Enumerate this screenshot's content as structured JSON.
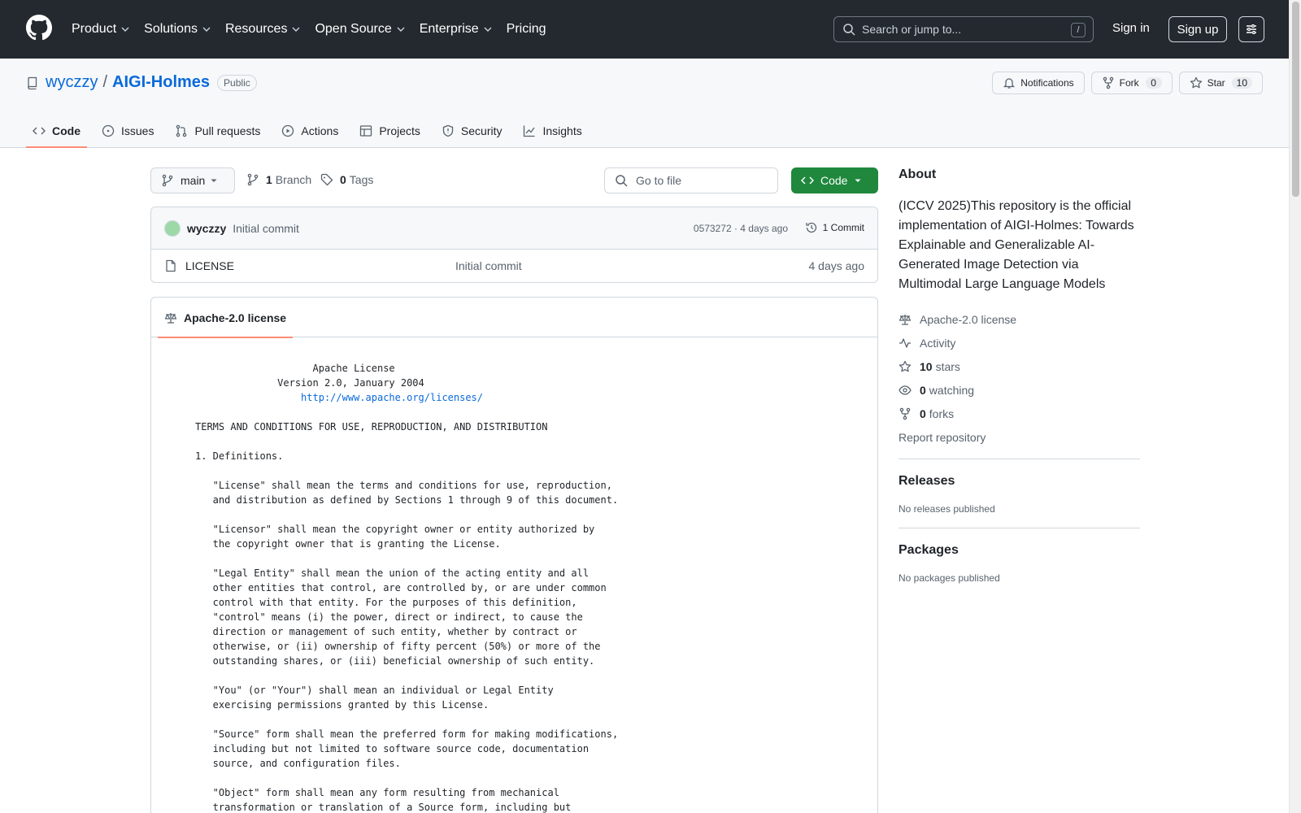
{
  "header": {
    "nav": [
      "Product",
      "Solutions",
      "Resources",
      "Open Source",
      "Enterprise",
      "Pricing"
    ],
    "search_placeholder": "Search or jump to...",
    "search_shortcut": "/",
    "sign_in": "Sign in",
    "sign_up": "Sign up"
  },
  "repo": {
    "owner": "wyczzy",
    "separator": "/",
    "name": "AIGI-Holmes",
    "visibility": "Public",
    "notifications": "Notifications",
    "fork_label": "Fork",
    "fork_count": "0",
    "star_label": "Star",
    "star_count": "10",
    "tabs": [
      "Code",
      "Issues",
      "Pull requests",
      "Actions",
      "Projects",
      "Security",
      "Insights"
    ]
  },
  "toolbar": {
    "branch": "main",
    "branch_count": "1",
    "branch_label": "Branch",
    "tag_count": "0",
    "tag_label": "Tags",
    "goto_placeholder": "Go to file",
    "code_button": "Code"
  },
  "commit": {
    "author": "wyczzy",
    "message": "Initial commit",
    "meta": "0573272 · 4 days ago",
    "count_label": "1 Commit"
  },
  "files": [
    {
      "name": "LICENSE",
      "message": "Initial commit",
      "date": "4 days ago"
    }
  ],
  "license": {
    "tab": "Apache-2.0 license",
    "line1": "                    Apache License",
    "line2": "              Version 2.0, January 2004",
    "url": "http://www.apache.org/licenses/",
    "body": "TERMS AND CONDITIONS FOR USE, REPRODUCTION, AND DISTRIBUTION\n\n1. Definitions.\n\n   \"License\" shall mean the terms and conditions for use, reproduction,\n   and distribution as defined by Sections 1 through 9 of this document.\n\n   \"Licensor\" shall mean the copyright owner or entity authorized by\n   the copyright owner that is granting the License.\n\n   \"Legal Entity\" shall mean the union of the acting entity and all\n   other entities that control, are controlled by, or are under common\n   control with that entity. For the purposes of this definition,\n   \"control\" means (i) the power, direct or indirect, to cause the\n   direction or management of such entity, whether by contract or\n   otherwise, or (ii) ownership of fifty percent (50%) or more of the\n   outstanding shares, or (iii) beneficial ownership of such entity.\n\n   \"You\" (or \"Your\") shall mean an individual or Legal Entity\n   exercising permissions granted by this License.\n\n   \"Source\" form shall mean the preferred form for making modifications,\n   including but not limited to software source code, documentation\n   source, and configuration files.\n\n   \"Object\" form shall mean any form resulting from mechanical\n   transformation or translation of a Source form, including but"
  },
  "sidebar": {
    "about_title": "About",
    "description": "(ICCV 2025)This repository is the official implementation of AIGI-Holmes: Towards Explainable and Generalizable AI-Generated Image Detection via Multimodal Large Language Models",
    "license": "Apache-2.0 license",
    "activity": "Activity",
    "stars_count": "10",
    "stars_label": "stars",
    "watching_count": "0",
    "watching_label": "watching",
    "forks_count": "0",
    "forks_label": "forks",
    "report": "Report repository",
    "releases_title": "Releases",
    "releases_empty": "No releases published",
    "packages_title": "Packages",
    "packages_empty": "No packages published"
  }
}
